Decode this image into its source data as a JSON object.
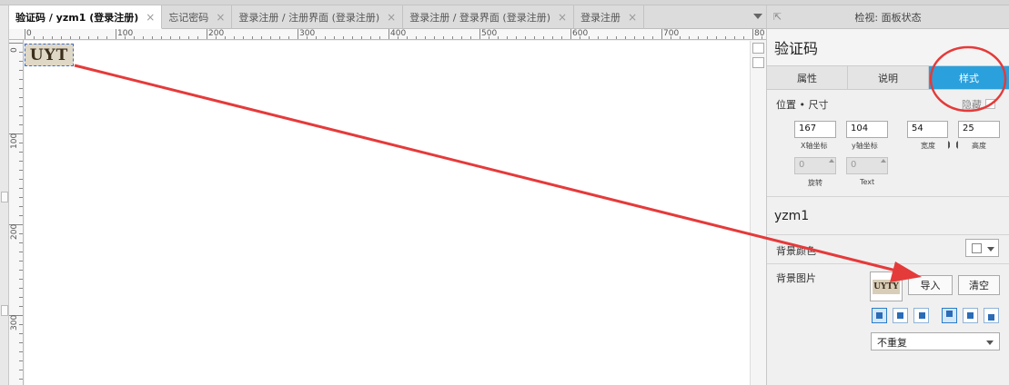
{
  "tabs": [
    {
      "label": "验证码 / yzm1 (登录注册)",
      "active": true
    },
    {
      "label": "忘记密码",
      "active": false
    },
    {
      "label": "登录注册 / 注册界面 (登录注册)",
      "active": false
    },
    {
      "label": "登录注册 / 登录界面 (登录注册)",
      "active": false
    },
    {
      "label": "登录注册",
      "active": false
    }
  ],
  "tab_close_glyph": "×",
  "ruler": {
    "top_labels": [
      "0",
      "100",
      "200",
      "300",
      "400",
      "500",
      "600",
      "700",
      "80"
    ],
    "left_labels": [
      "0",
      "100",
      "200",
      "300"
    ]
  },
  "canvas": {
    "captcha_text": "UYT"
  },
  "panel": {
    "header_title": "检视: 面板状态",
    "collapse_icon": "⇱",
    "widget_name": "验证码",
    "tabs": [
      {
        "label": "属性",
        "active": false
      },
      {
        "label": "说明",
        "active": false
      },
      {
        "label": "样式",
        "active": true
      }
    ],
    "position_size_label": "位置 • 尺寸",
    "hidden_label": "隐藏",
    "x_value": "167",
    "y_value": "104",
    "width_value": "54",
    "height_value": "25",
    "x_label": "X轴坐标",
    "y_label": "y轴坐标",
    "width_label": "宽度",
    "height_label": "高度",
    "rotate_value": "0",
    "text_rotate_value": "0",
    "rotate_label": "旋转",
    "text_label": "Text",
    "state_name": "yzm1",
    "bg_color_label": "背景颜色",
    "bg_image_label": "背景图片",
    "thumb_text": "UYTY",
    "import_label": "导入",
    "clear_label": "清空",
    "repeat_value": "不重复"
  },
  "annotations": {
    "arrow_color": "#e53a3a",
    "circle_color": "#e53a3a"
  },
  "colors": {
    "active_tab_accent": "#2aa0dc",
    "selection_border": "#3a6cc7"
  }
}
